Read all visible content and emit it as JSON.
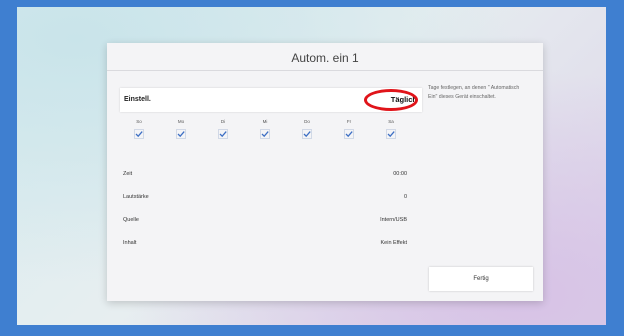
{
  "dialog": {
    "title": "Autom. ein 1",
    "setting_label": "Einstell.",
    "setting_value": "Täglich",
    "help_text": "Tage festlegen, an denen \" Automatisch Ein\" dieses Gerät einschaltet.",
    "done_label": "Fertig"
  },
  "days": [
    {
      "label": "So",
      "checked": true
    },
    {
      "label": "Mo",
      "checked": true
    },
    {
      "label": "Di",
      "checked": true
    },
    {
      "label": "Mi",
      "checked": true
    },
    {
      "label": "Do",
      "checked": true
    },
    {
      "label": "Fr",
      "checked": true
    },
    {
      "label": "Sa",
      "checked": true
    }
  ],
  "rows": [
    {
      "label": "Zeit",
      "value": "00:00"
    },
    {
      "label": "Lautstärke",
      "value": "0"
    },
    {
      "label": "Quelle",
      "value": "Intern/USB"
    },
    {
      "label": "Inhalt",
      "value": "Kein Effekt"
    }
  ],
  "colors": {
    "highlight_oval": "#e0141a",
    "check": "#3d6fc4"
  }
}
